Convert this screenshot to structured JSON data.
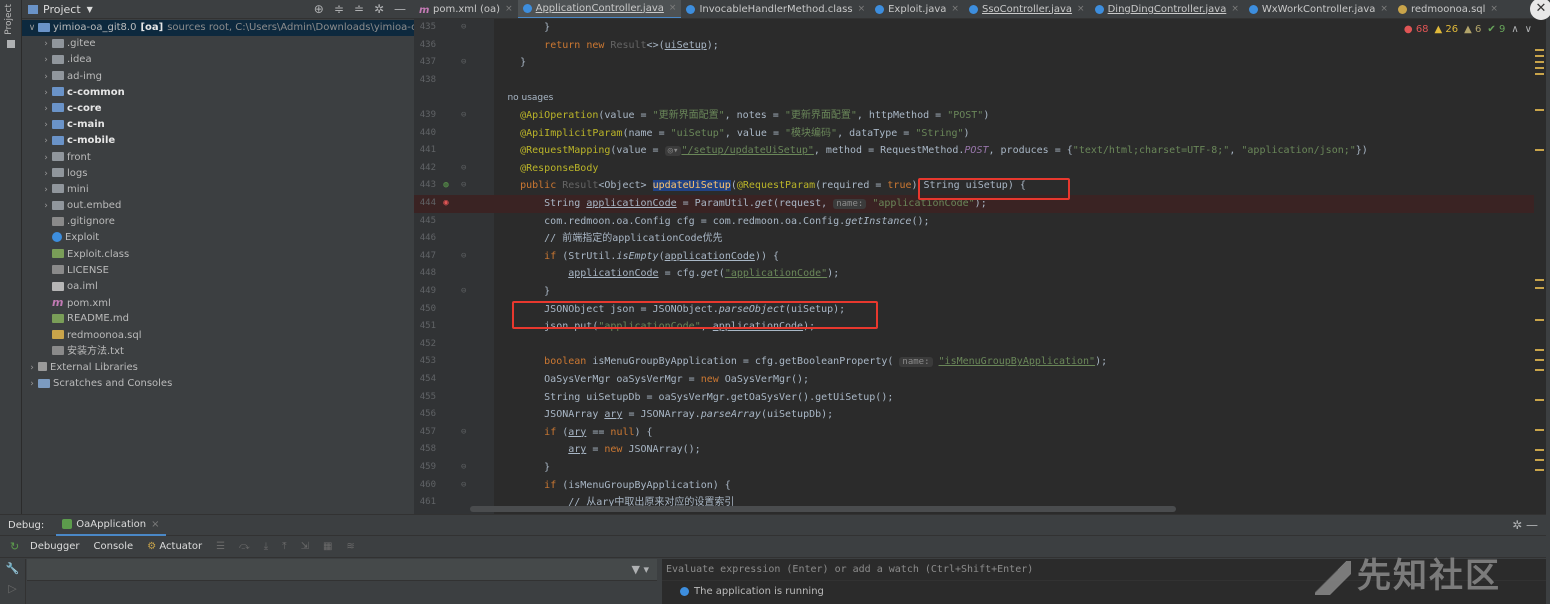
{
  "sidebar_strip": {
    "label": "Project"
  },
  "project": {
    "title": "Project",
    "tree": [
      {
        "name": "yimioa-oa_git8.0",
        "module": "[oa]",
        "hint": "sources root, C:\\Users\\Admin\\Downloads\\yimioa-oa",
        "icon": "module-folder-icon",
        "arrow": "v",
        "indent": 0,
        "bold": false
      },
      {
        "name": ".gitee",
        "icon": "folder-icon",
        "arrow": ">",
        "indent": 1
      },
      {
        "name": ".idea",
        "icon": "folder-icon",
        "arrow": ">",
        "indent": 1
      },
      {
        "name": "ad-img",
        "icon": "folder-icon",
        "arrow": ">",
        "indent": 1
      },
      {
        "name": "c-common",
        "icon": "module-folder-icon",
        "arrow": ">",
        "indent": 1,
        "bold": true
      },
      {
        "name": "c-core",
        "icon": "module-folder-icon",
        "arrow": ">",
        "indent": 1,
        "bold": true
      },
      {
        "name": "c-main",
        "icon": "module-folder-icon",
        "arrow": ">",
        "indent": 1,
        "bold": true
      },
      {
        "name": "c-mobile",
        "icon": "module-folder-icon",
        "arrow": ">",
        "indent": 1,
        "bold": true
      },
      {
        "name": "front",
        "icon": "folder-icon",
        "arrow": ">",
        "indent": 1
      },
      {
        "name": "logs",
        "icon": "folder-icon",
        "arrow": ">",
        "indent": 1
      },
      {
        "name": "mini",
        "icon": "folder-icon",
        "arrow": ">",
        "indent": 1
      },
      {
        "name": "out.embed",
        "icon": "folder-icon",
        "arrow": ">",
        "indent": 1
      },
      {
        "name": ".gitignore",
        "icon": "gitignore-icon",
        "arrow": "",
        "indent": 1
      },
      {
        "name": "Exploit",
        "icon": "java-class-icon",
        "arrow": "",
        "indent": 1
      },
      {
        "name": "Exploit.class",
        "icon": "class-file-icon",
        "arrow": "",
        "indent": 1
      },
      {
        "name": "LICENSE",
        "icon": "text-file-icon",
        "arrow": "",
        "indent": 1
      },
      {
        "name": "oa.iml",
        "icon": "iml-file-icon",
        "arrow": "",
        "indent": 1
      },
      {
        "name": "pom.xml",
        "icon": "maven-icon",
        "arrow": "",
        "indent": 1
      },
      {
        "name": "README.md",
        "icon": "markdown-icon",
        "arrow": "",
        "indent": 1
      },
      {
        "name": "redmoonoa.sql",
        "icon": "sql-file-icon",
        "arrow": "",
        "indent": 1
      },
      {
        "name": "安装方法.txt",
        "icon": "text-file-icon",
        "arrow": "",
        "indent": 1
      },
      {
        "name": "External Libraries",
        "icon": "library-icon",
        "arrow": ">",
        "indent": 0
      },
      {
        "name": "Scratches and Consoles",
        "icon": "scratches-icon",
        "arrow": ">",
        "indent": 0
      }
    ]
  },
  "tabs": [
    {
      "label": "pom.xml (oa)",
      "icon": "maven-icon",
      "color": "#c27ab4",
      "active": false,
      "underline": false
    },
    {
      "label": "ApplicationController.java",
      "icon": "java-class-icon",
      "color": "#3d8ede",
      "active": true,
      "underline": true
    },
    {
      "label": "InvocableHandlerMethod.class",
      "icon": "java-class-icon",
      "color": "#3d8ede",
      "active": false,
      "underline": false
    },
    {
      "label": "Exploit.java",
      "icon": "java-class-icon",
      "color": "#3d8ede",
      "active": false,
      "underline": false
    },
    {
      "label": "SsoController.java",
      "icon": "java-class-icon",
      "color": "#3d8ede",
      "active": false,
      "underline": true
    },
    {
      "label": "DingDingController.java",
      "icon": "java-class-icon",
      "color": "#3d8ede",
      "active": false,
      "underline": true
    },
    {
      "label": "WxWorkController.java",
      "icon": "java-class-icon",
      "color": "#3d8ede",
      "active": false,
      "underline": false
    },
    {
      "label": "redmoonoa.sql",
      "icon": "sql-file-icon",
      "color": "#c9a44a",
      "active": false,
      "underline": false
    }
  ],
  "inspections": {
    "errors": "68",
    "warnings": "26",
    "weak": "6",
    "ok": "9"
  },
  "debug": {
    "label": "Debug:",
    "session": "OaApplication",
    "tabs": [
      "Debugger",
      "Console",
      "Actuator"
    ],
    "eval_placeholder": "Evaluate expression (Enter) or add a watch (Ctrl+Shift+Enter)",
    "status": "The application is running"
  },
  "watermark": "先知社区"
}
